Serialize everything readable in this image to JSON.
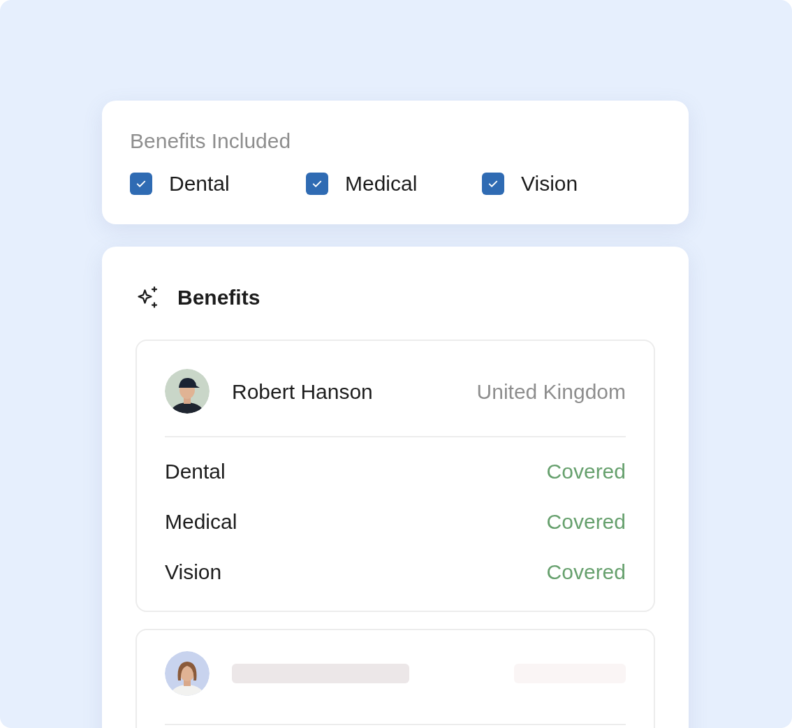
{
  "filter": {
    "title": "Benefits Included",
    "options": [
      {
        "label": "Dental",
        "checked": true
      },
      {
        "label": "Medical",
        "checked": true
      },
      {
        "label": "Vision",
        "checked": true
      }
    ]
  },
  "benefits": {
    "title": "Benefits",
    "employees": [
      {
        "kind": "loaded",
        "name": "Robert Hanson",
        "country": "United Kingdom",
        "coverage": [
          {
            "benefit": "Dental",
            "status": "Covered"
          },
          {
            "benefit": "Medical",
            "status": "Covered"
          },
          {
            "benefit": "Vision",
            "status": "Covered"
          }
        ]
      },
      {
        "kind": "loading"
      }
    ]
  }
}
